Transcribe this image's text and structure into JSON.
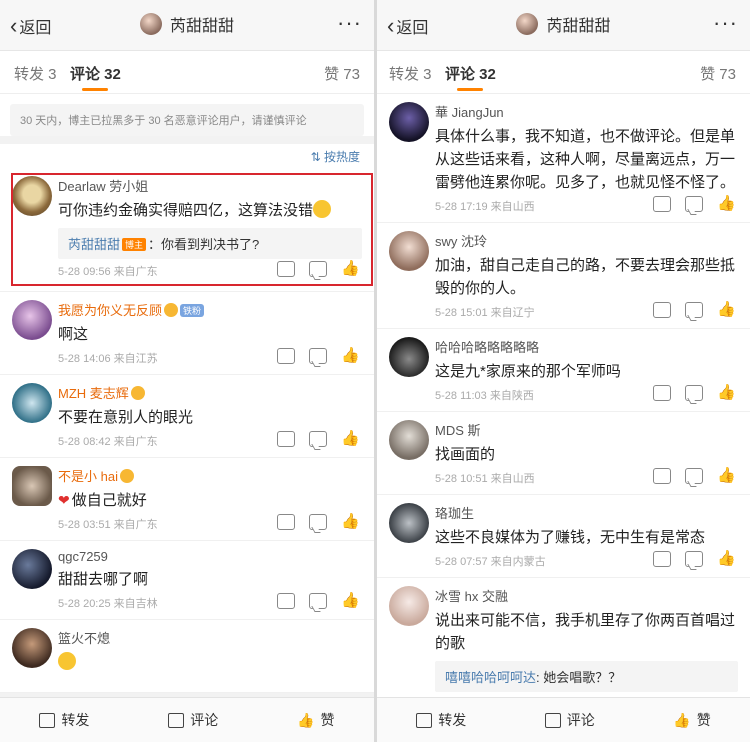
{
  "header": {
    "back_label": "返回",
    "title": "芮甜甜甜",
    "more": "···"
  },
  "tabs": {
    "repost": "转发 3",
    "comments": "评论 32",
    "likes": "赞 73"
  },
  "notice": "30 天内，博主已拉黑多于 30 名恶意评论用户，请谨慎评论",
  "sort_label": "按热度",
  "left_comments": [
    {
      "name": "Dearlaw 劳小姐",
      "text": "可你违约金确实得赔四亿，这算法没错",
      "time": "5-28 09:56  来自广东",
      "reply": {
        "name": "芮甜甜甜",
        "tag": "博主",
        "text": "：你看到判决书了?"
      }
    },
    {
      "name": "我愿为你义无反顾",
      "text": "啊这",
      "time": "5-28 14:06  来自江苏"
    },
    {
      "name": "MZH 麦志辉",
      "text": "不要在意别人的眼光",
      "time": "5-28 08:42  来自广东"
    },
    {
      "name": "不是小 hai",
      "text": "做自己就好",
      "time": "5-28 03:51  来自广东"
    },
    {
      "name": "qgc7259",
      "text": "甜甜去哪了啊",
      "time": "5-28 20:25  来自吉林"
    },
    {
      "name": "篮火不熄",
      "text": "",
      "time": ""
    }
  ],
  "right_comments": [
    {
      "name": "華 JiangJun",
      "text": "具体什么事，我不知道，也不做评论。但是单从这些话来看，这种人啊，尽量离远点，万一雷劈他连累你呢。见多了，也就见怪不怪了。",
      "time": "5-28 17:19  来自山西"
    },
    {
      "name": "swy 沈玲",
      "text": "加油，甜自己走自己的路，不要去理会那些抵毁的你的人。",
      "time": "5-28 15:01  来自辽宁"
    },
    {
      "name": "哈哈哈略略略略略",
      "text": "这是九*家原来的那个军师吗",
      "time": "5-28 11:03  来自陕西"
    },
    {
      "name": "MDS 斯",
      "text": "找画面的",
      "time": "5-28 10:51  来自山西"
    },
    {
      "name": "珞珈生",
      "text": "这些不良媒体为了赚钱，无中生有是常态",
      "time": "5-28 07:57  来自内蒙古"
    },
    {
      "name": "冰雪 hx 交融",
      "text": "说出来可能不信，我手机里存了你两百首唱过的歌",
      "time": "",
      "reply": {
        "name": "嘻嘻哈哈呵呵达",
        "text": ": 她会唱歌？？"
      }
    }
  ],
  "bottom": {
    "repost": "转发",
    "comment": "评论",
    "like": "赞"
  },
  "colors": {
    "accent": "#ff8200",
    "link": "#4a7cae",
    "highlight": "#d8262e"
  }
}
